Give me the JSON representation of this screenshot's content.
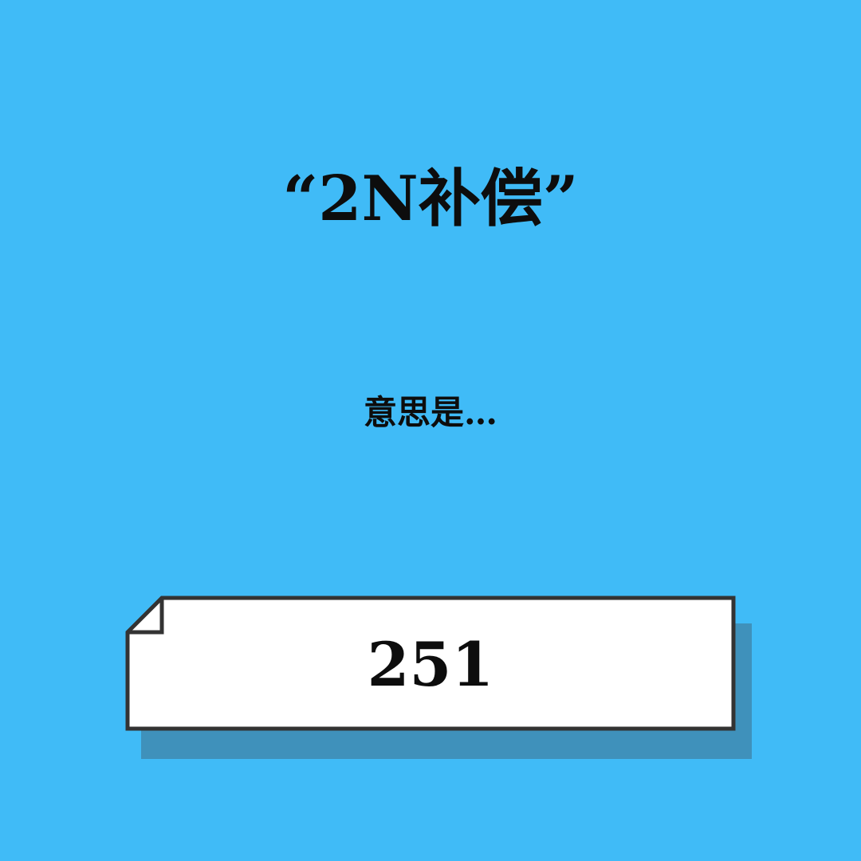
{
  "title": "“2N补偿”",
  "subtitle": "意思是…",
  "card": {
    "value": "251"
  },
  "colors": {
    "background": "#40bbf7",
    "card_fill": "#ffffff",
    "card_border": "#333333",
    "card_shadow": "#3f91bb",
    "text": "#0d0d0d"
  }
}
